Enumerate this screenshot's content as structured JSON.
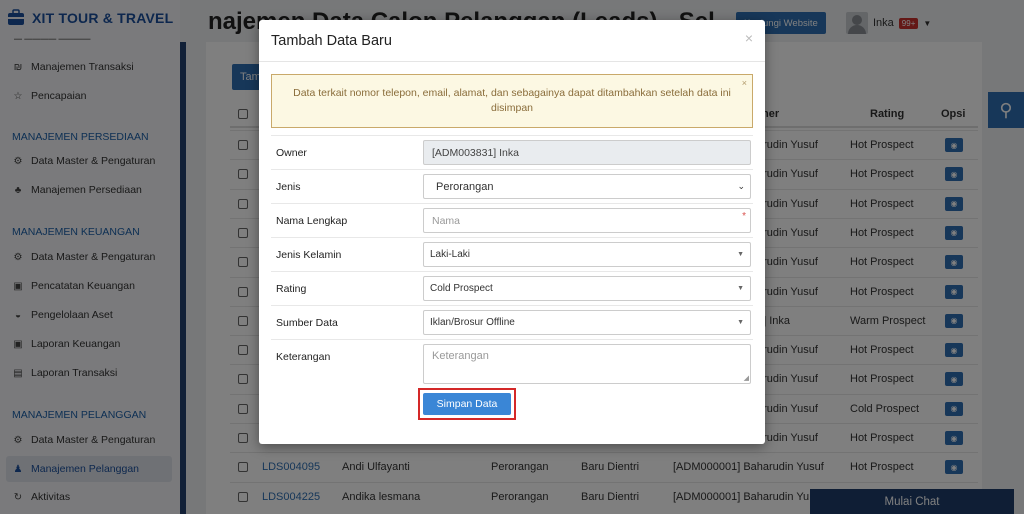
{
  "app": {
    "brand": "XIT TOUR & TRAVEL",
    "page_title": "najemen Data Calon Pelanggan (Leads) - Sel",
    "visit_website": "Kunjungi Website",
    "user_name": "Inka",
    "notif_badge": "99+",
    "chat_label": "Mulai Chat",
    "add_button": "Tam"
  },
  "sidebar": {
    "items": [
      {
        "label": "Manajemen Transaksi",
        "icon": "money-icon"
      },
      {
        "label": "Pencapaian",
        "icon": "star-icon"
      }
    ],
    "sections": [
      {
        "heading": "MANAJEMEN PERSEDIAAN",
        "items": [
          {
            "label": "Data Master & Pengaturan",
            "icon": "gears-icon"
          },
          {
            "label": "Manajemen Persediaan",
            "icon": "people-icon"
          }
        ]
      },
      {
        "heading": "MANAJEMEN KEUANGAN",
        "items": [
          {
            "label": "Data Master & Pengaturan",
            "icon": "gears-icon"
          },
          {
            "label": "Pencatatan Keuangan",
            "icon": "money-icon"
          },
          {
            "label": "Pengelolaan Aset",
            "icon": "lock-icon"
          },
          {
            "label": "Laporan Keuangan",
            "icon": "money-icon"
          },
          {
            "label": "Laporan Transaksi",
            "icon": "book-icon"
          }
        ]
      },
      {
        "heading": "MANAJEMEN PELANGGAN",
        "items": [
          {
            "label": "Data Master & Pengaturan",
            "icon": "gears-icon"
          },
          {
            "label": "Manajemen Pelanggan",
            "icon": "users-icon"
          },
          {
            "label": "Aktivitas",
            "icon": "refresh-icon"
          }
        ]
      }
    ]
  },
  "table": {
    "headers": {
      "owner": "ner",
      "rating": "Rating",
      "opsi": "Opsi"
    },
    "rows": [
      {
        "id": "",
        "name": "",
        "type": "",
        "status": "",
        "owner": "arudin Yusuf",
        "rating": "Hot Prospect"
      },
      {
        "id": "",
        "name": "",
        "type": "",
        "status": "",
        "owner": "arudin Yusuf",
        "rating": "Hot Prospect"
      },
      {
        "id": "",
        "name": "",
        "type": "",
        "status": "",
        "owner": "arudin Yusuf",
        "rating": "Hot Prospect"
      },
      {
        "id": "",
        "name": "",
        "type": "",
        "status": "",
        "owner": "arudin Yusuf",
        "rating": "Hot Prospect"
      },
      {
        "id": "",
        "name": "",
        "type": "",
        "status": "",
        "owner": "arudin Yusuf",
        "rating": "Hot Prospect"
      },
      {
        "id": "",
        "name": "",
        "type": "",
        "status": "",
        "owner": "arudin Yusuf",
        "rating": "Hot Prospect"
      },
      {
        "id": "",
        "name": "",
        "type": "",
        "status": "",
        "owner": "1] Inka",
        "rating": "Warm Prospect"
      },
      {
        "id": "",
        "name": "",
        "type": "",
        "status": "",
        "owner": "arudin Yusuf",
        "rating": "Hot Prospect"
      },
      {
        "id": "",
        "name": "",
        "type": "",
        "status": "",
        "owner": "arudin Yusuf",
        "rating": "Hot Prospect"
      },
      {
        "id": "",
        "name": "",
        "type": "",
        "status": "",
        "owner": "arudin Yusuf",
        "rating": "Cold Prospect"
      },
      {
        "id": "",
        "name": "",
        "type": "",
        "status": "",
        "owner": "arudin Yusuf",
        "rating": "Hot Prospect"
      },
      {
        "id": "LDS004095",
        "name": "Andi Ulfayanti",
        "type": "Perorangan",
        "status": "Baru Dientri",
        "owner": "[ADM000001] Baharudin Yusuf",
        "rating": "Hot Prospect"
      },
      {
        "id": "LDS004225",
        "name": "Andika lesmana",
        "type": "Perorangan",
        "status": "Baru Dientri",
        "owner": "[ADM000001] Baharudin Yu",
        "rating": ""
      }
    ]
  },
  "modal": {
    "title": "Tambah Data Baru",
    "close": "×",
    "alert": "Data terkait nomor telepon, email, alamat, dan sebagainya dapat ditambahkan setelah data ini disimpan",
    "alert_close": "×",
    "fields": {
      "owner": {
        "label": "Owner",
        "value": "[ADM003831] Inka"
      },
      "jenis": {
        "label": "Jenis",
        "value": "Perorangan"
      },
      "nama": {
        "label": "Nama Lengkap",
        "placeholder": "Nama",
        "required_mark": "*"
      },
      "kelamin": {
        "label": "Jenis Kelamin",
        "value": "Laki-Laki"
      },
      "rating": {
        "label": "Rating",
        "value": "Cold Prospect"
      },
      "sumber": {
        "label": "Sumber Data",
        "value": "Iklan/Brosur Offline"
      },
      "keterangan": {
        "label": "Keterangan",
        "placeholder": "Keterangan"
      }
    },
    "save_label": "Simpan Data"
  },
  "colors": {
    "primary": "#2e6fb3",
    "highlight": "#d42828",
    "alert_bg": "#fcf8e3"
  }
}
